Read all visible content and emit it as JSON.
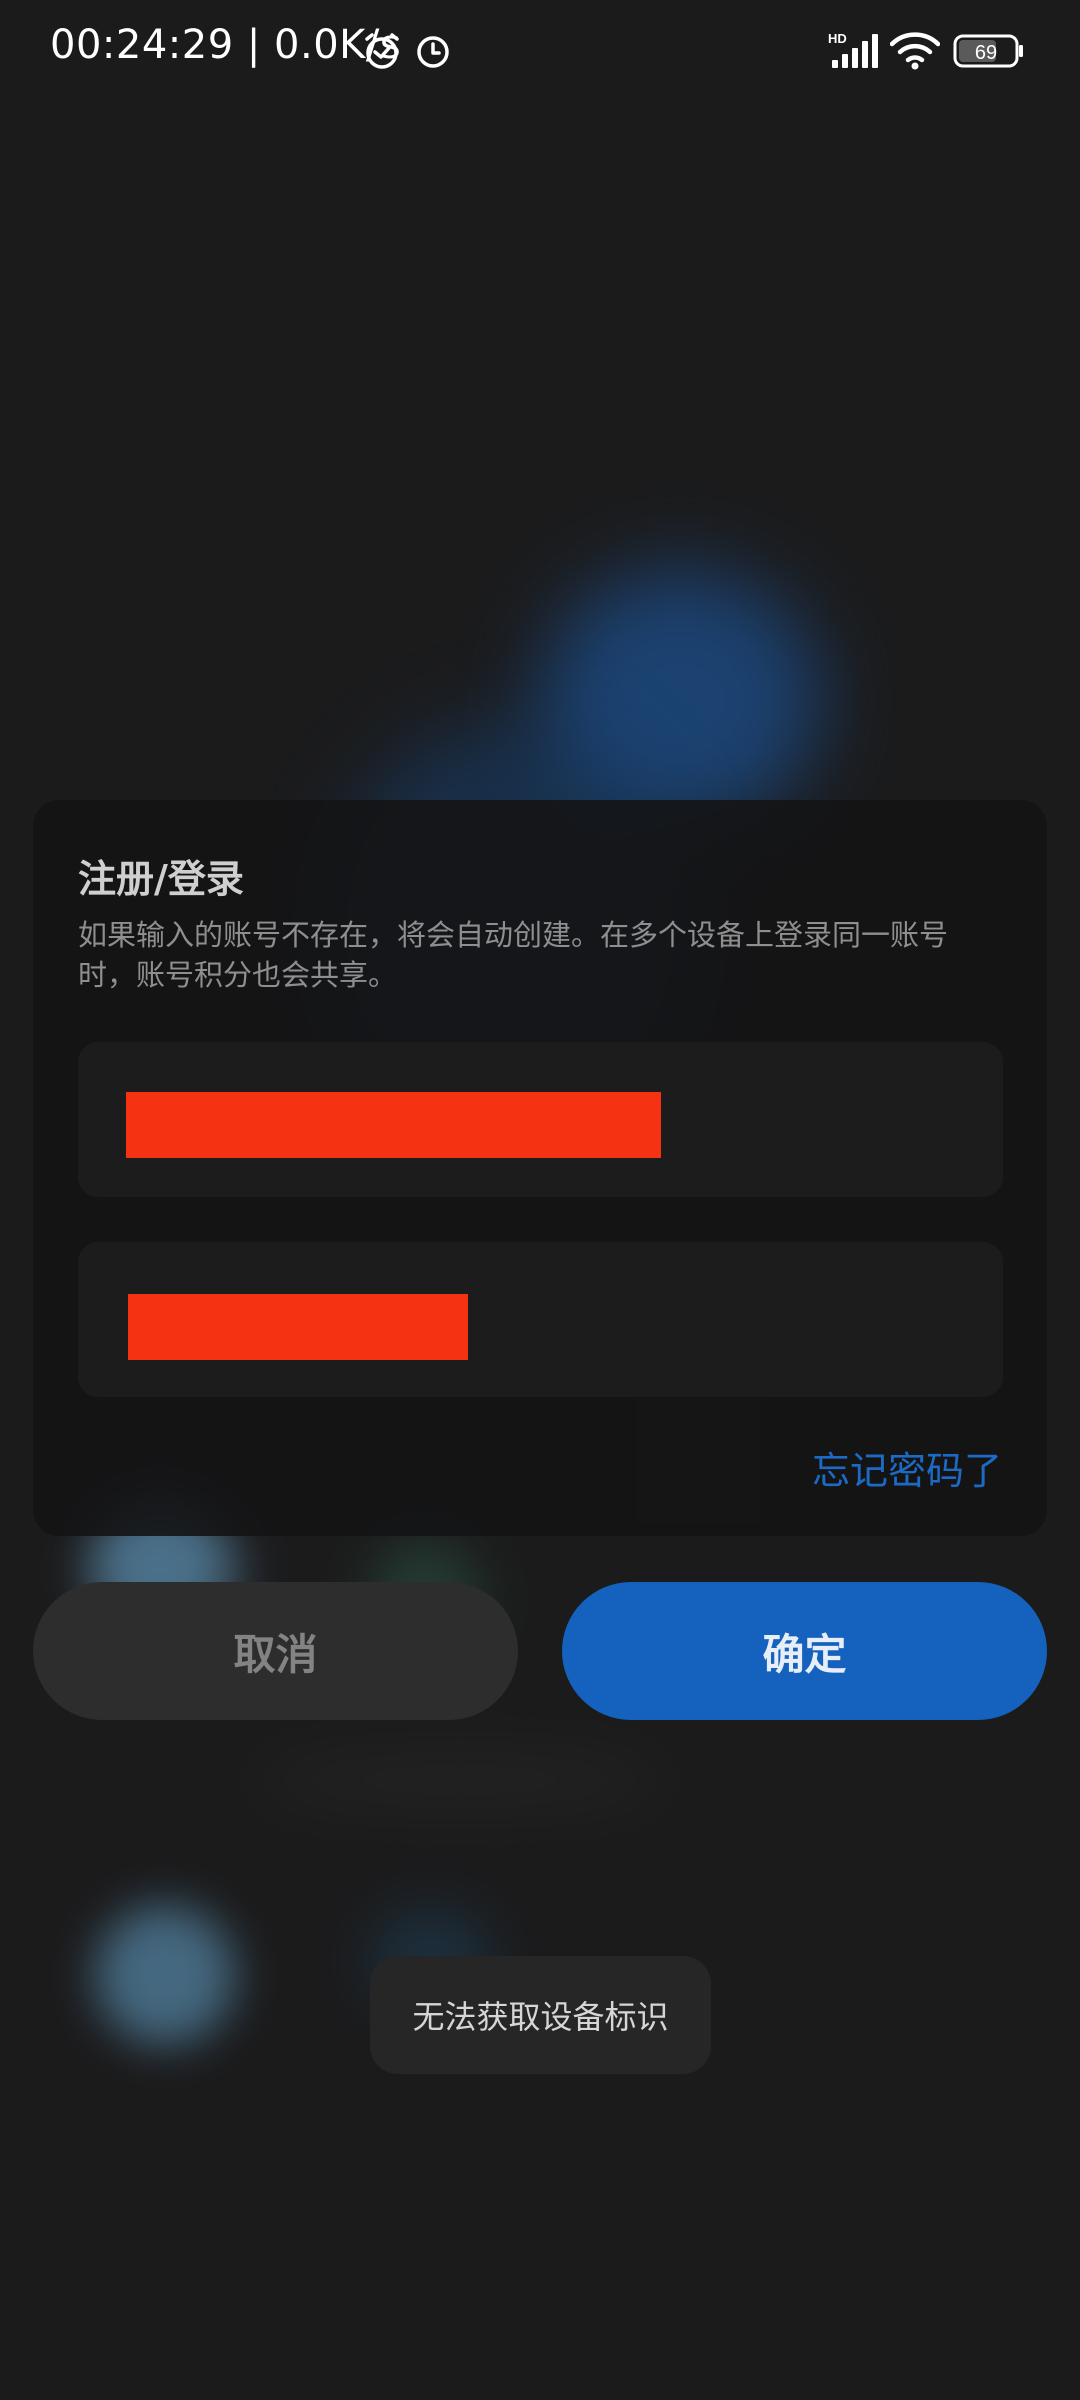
{
  "status_bar": {
    "time_and_speed": "00:24:29 | 0.0K/s",
    "network_badge": "HD",
    "battery_level": "69",
    "icons": [
      "alarm-icon",
      "clock-icon",
      "signal-icon",
      "wifi-icon",
      "battery-icon"
    ]
  },
  "dialog": {
    "title": "注册/登录",
    "description": "如果输入的账号不存在，将会自动创建。在多个设备上登录同一账号时，账号积分也会共享。",
    "forgot_password": "忘记密码了"
  },
  "buttons": {
    "cancel": "取消",
    "confirm": "确定"
  },
  "toast": {
    "message": "无法获取设备标识"
  },
  "colors": {
    "accent_blue": "#1462bd",
    "link_blue": "#1c6ac6",
    "redaction": "#f53313",
    "background": "#1b1b1c"
  }
}
